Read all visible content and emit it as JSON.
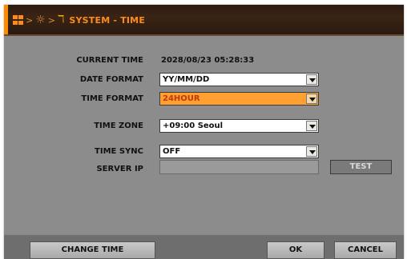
{
  "window": {
    "title": "SYSTEM - TIME",
    "breadcrumb_icons": [
      "grid-icon",
      "gear-icon",
      "tools-icon"
    ],
    "accent_color": "#ff8a00"
  },
  "form": {
    "current_time": {
      "label": "CURRENT TIME",
      "value": "2028/08/23 05:28:33"
    },
    "date_format": {
      "label": "DATE FORMAT",
      "value": "YY/MM/DD"
    },
    "time_format": {
      "label": "TIME FORMAT",
      "value": "24HOUR"
    },
    "time_zone": {
      "label": "TIME ZONE",
      "value": "+09:00 Seoul"
    },
    "time_sync": {
      "label": "TIME SYNC",
      "value": "OFF"
    },
    "server_ip": {
      "label": "SERVER IP",
      "value": ""
    },
    "test_label": "TEST"
  },
  "footer": {
    "change_time_label": "CHANGE TIME",
    "ok_label": "OK",
    "cancel_label": "CANCEL"
  }
}
